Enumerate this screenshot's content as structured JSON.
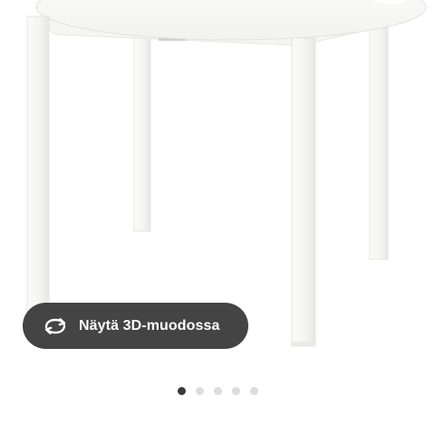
{
  "colors": {
    "button_bg": "#444444",
    "button_text": "#ffffff",
    "dot_active": "#3a3a3a",
    "dot_inactive": "#dcdcdc",
    "table_color": "#f7f7f5"
  },
  "viewer": {
    "button_label": "Näytä 3D-muodossa",
    "button_icon": "rotate-360-icon"
  },
  "carousel": {
    "total_images": 5,
    "active_index": 0
  }
}
